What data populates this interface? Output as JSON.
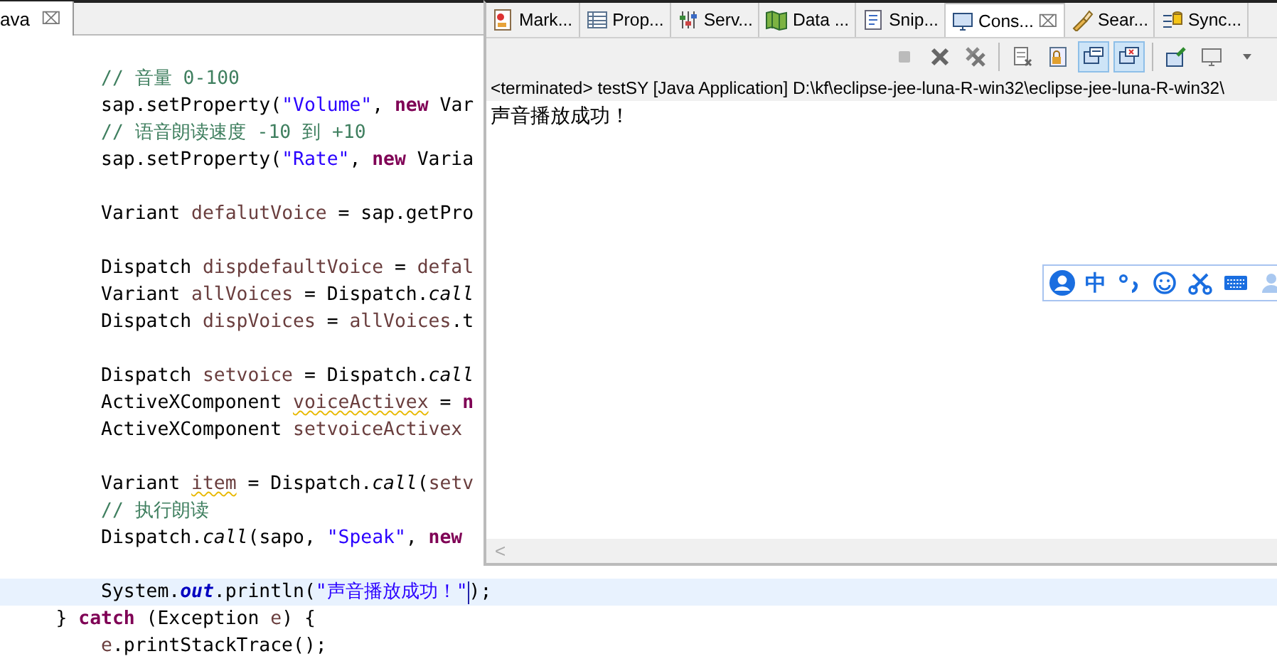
{
  "editor": {
    "tab": {
      "label": "ava",
      "close": "⌧"
    },
    "lines": [
      {
        "blank_before": false,
        "tokens": [
          {
            "text": "        // 音量 0-100",
            "kind": "comment"
          }
        ]
      },
      {
        "blank_before": false,
        "tokens": [
          {
            "text": "        sap.setProperty(",
            "kind": "plain"
          },
          {
            "text": "\"Volume\"",
            "kind": "string"
          },
          {
            "text": ", ",
            "kind": "plain"
          },
          {
            "text": "new",
            "kind": "keyword"
          },
          {
            "text": " Var",
            "kind": "plain"
          }
        ]
      },
      {
        "blank_before": false,
        "tokens": [
          {
            "text": "        // 语音朗读速度 -10 到 +10",
            "kind": "comment"
          }
        ]
      },
      {
        "blank_before": false,
        "tokens": [
          {
            "text": "        sap.setProperty(",
            "kind": "plain"
          },
          {
            "text": "\"Rate\"",
            "kind": "string"
          },
          {
            "text": ", ",
            "kind": "plain"
          },
          {
            "text": "new",
            "kind": "keyword"
          },
          {
            "text": " Varia",
            "kind": "plain"
          }
        ]
      },
      {
        "blank_before": true,
        "tokens": [
          {
            "text": "        Variant ",
            "kind": "plain"
          },
          {
            "text": "defalutVoice",
            "kind": "local"
          },
          {
            "text": " = sap.getPro",
            "kind": "plain"
          }
        ]
      },
      {
        "blank_before": true,
        "tokens": [
          {
            "text": "        Dispatch ",
            "kind": "plain"
          },
          {
            "text": "dispdefaultVoice",
            "kind": "local"
          },
          {
            "text": " = ",
            "kind": "plain"
          },
          {
            "text": "defal",
            "kind": "local"
          }
        ]
      },
      {
        "blank_before": false,
        "tokens": [
          {
            "text": "        Variant ",
            "kind": "plain"
          },
          {
            "text": "allVoices",
            "kind": "local"
          },
          {
            "text": " = Dispatch.",
            "kind": "plain"
          },
          {
            "text": "call",
            "kind": "static"
          }
        ]
      },
      {
        "blank_before": false,
        "tokens": [
          {
            "text": "        Dispatch ",
            "kind": "plain"
          },
          {
            "text": "dispVoices",
            "kind": "local"
          },
          {
            "text": " = ",
            "kind": "plain"
          },
          {
            "text": "allVoices",
            "kind": "local"
          },
          {
            "text": ".t",
            "kind": "plain"
          }
        ]
      },
      {
        "blank_before": true,
        "tokens": [
          {
            "text": "        Dispatch ",
            "kind": "plain"
          },
          {
            "text": "setvoice",
            "kind": "local"
          },
          {
            "text": " = Dispatch.",
            "kind": "plain"
          },
          {
            "text": "call",
            "kind": "static"
          }
        ]
      },
      {
        "blank_before": false,
        "tokens": [
          {
            "text": "        ActiveXComponent ",
            "kind": "plain"
          },
          {
            "text": "voiceActivex",
            "kind": "warning"
          },
          {
            "text": " = ",
            "kind": "plain"
          },
          {
            "text": "n",
            "kind": "keyword"
          }
        ]
      },
      {
        "blank_before": false,
        "tokens": [
          {
            "text": "        ActiveXComponent ",
            "kind": "plain"
          },
          {
            "text": "setvoiceActivex",
            "kind": "local"
          }
        ]
      },
      {
        "blank_before": true,
        "tokens": [
          {
            "text": "        Variant ",
            "kind": "plain"
          },
          {
            "text": "item",
            "kind": "warning"
          },
          {
            "text": " = Dispatch.",
            "kind": "plain"
          },
          {
            "text": "call",
            "kind": "static"
          },
          {
            "text": "(",
            "kind": "plain"
          },
          {
            "text": "setv",
            "kind": "local"
          }
        ]
      },
      {
        "blank_before": false,
        "tokens": [
          {
            "text": "        // 执行朗读",
            "kind": "comment"
          }
        ]
      },
      {
        "blank_before": false,
        "tokens": [
          {
            "text": "        Dispatch.",
            "kind": "plain"
          },
          {
            "text": "call",
            "kind": "static"
          },
          {
            "text": "(sapo, ",
            "kind": "plain"
          },
          {
            "text": "\"Speak\"",
            "kind": "string"
          },
          {
            "text": ", ",
            "kind": "plain"
          },
          {
            "text": "new",
            "kind": "keyword"
          }
        ]
      },
      {
        "blank_before": true,
        "current": true,
        "tokens": [
          {
            "text": "        System.",
            "kind": "plain"
          },
          {
            "text": "out",
            "kind": "field"
          },
          {
            "text": ".println(",
            "kind": "plain"
          },
          {
            "text": "\"声音播放成功！\"",
            "kind": "string"
          },
          {
            "text": ");",
            "kind": "plain"
          }
        ]
      },
      {
        "blank_before": false,
        "tokens": [
          {
            "text": "    } ",
            "kind": "plain"
          },
          {
            "text": "catch",
            "kind": "keyword"
          },
          {
            "text": " (Exception ",
            "kind": "plain"
          },
          {
            "text": "e",
            "kind": "local"
          },
          {
            "text": ") {",
            "kind": "plain"
          }
        ]
      },
      {
        "blank_before": false,
        "tokens": [
          {
            "text": "        e",
            "kind": "local"
          },
          {
            "text": ".printStackTrace();",
            "kind": "plain"
          }
        ]
      }
    ]
  },
  "console": {
    "tabs": [
      {
        "label": "Mark...",
        "selected": false
      },
      {
        "label": "Prop...",
        "selected": false
      },
      {
        "label": "Serv...",
        "selected": false
      },
      {
        "label": "Data ...",
        "selected": false
      },
      {
        "label": "Snip...",
        "selected": false
      },
      {
        "label": "Cons...",
        "selected": true,
        "close": "⌧"
      },
      {
        "label": "Sear...",
        "selected": false
      },
      {
        "label": "Sync...",
        "selected": false
      }
    ],
    "toolbar": [
      {
        "kind": "stop",
        "pressed": false
      },
      {
        "kind": "remove",
        "pressed": false
      },
      {
        "kind": "remove-all",
        "pressed": false
      },
      {
        "kind": "sep"
      },
      {
        "kind": "clear",
        "pressed": false
      },
      {
        "kind": "lock",
        "pressed": false
      },
      {
        "kind": "stdout",
        "pressed": true
      },
      {
        "kind": "stderr",
        "pressed": true
      },
      {
        "kind": "sep"
      },
      {
        "kind": "pin",
        "pressed": false
      },
      {
        "kind": "display",
        "pressed": false
      },
      {
        "kind": "menu",
        "pressed": false
      }
    ],
    "process": "<terminated> testSY [Java Application] D:\\kf\\eclipse-jee-luna-R-win32\\eclipse-jee-luna-R-win32\\",
    "output": "声音播放成功！",
    "scroll_arrow": "<"
  },
  "ime_bar": {
    "mode": "中"
  }
}
